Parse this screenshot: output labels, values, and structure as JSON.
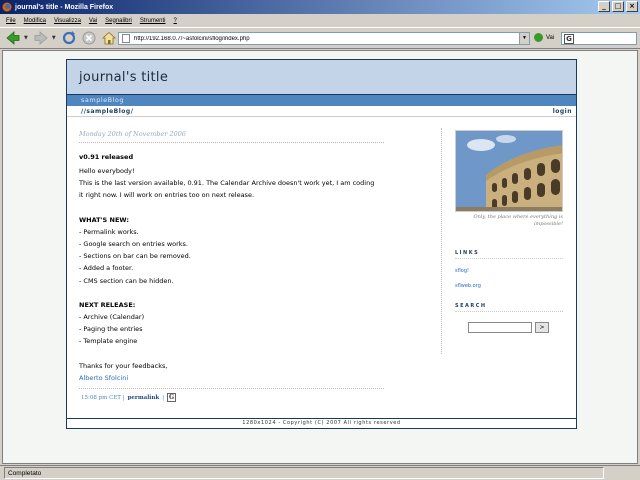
{
  "window": {
    "title": "journal's title - Mozilla Firefox",
    "buttons": {
      "minimize": "_",
      "maximize": "□",
      "close": "×"
    }
  },
  "menu": [
    "File",
    "Modifica",
    "Visualizza",
    "Vai",
    "Segnalibri",
    "Strumenti",
    "?"
  ],
  "toolbar": {
    "url": "http://192.168.0.7/~asfolcini/sflog/index.php",
    "go_label": "Vai",
    "icons": [
      "back-icon",
      "forward-icon",
      "reload-icon",
      "stop-icon",
      "home-icon"
    ]
  },
  "blog": {
    "title": "journal's title",
    "blog_name": "sampleBlog",
    "breadcrumb": "//sampleBlog/",
    "login": "login",
    "post": {
      "date": "Monday 20th of November 2006",
      "title": "v0.91 released",
      "greeting": "Hello everybody!",
      "intro_1": "This is the last version available, 0.91. The Calendar Archive doesn't work yet, I am coding",
      "intro_2": "it right now. I will work on entries too on next release.",
      "whats_new_heading": "WHAT'S NEW:",
      "whats_new": [
        "- Permalink works.",
        "- Google search on entries works.",
        "- Sections on bar can be removed.",
        "- Added a footer.",
        "- CMS section can be hidden."
      ],
      "next_release_heading": "NEXT RELEASE:",
      "next_release": [
        "- Archive (Calendar)",
        "- Paging the entries",
        "- Template engine"
      ],
      "thanks": "Thanks for your feedbacks,",
      "author": "Alberto Sfolcini",
      "footer_time": "15:08 pm CET |",
      "permalink": "permalink",
      "footer_sep": "|",
      "google_btn": "G"
    },
    "sidebar": {
      "caption": "Only, the place where everything is impossible!",
      "links_heading": "LINKS",
      "links": [
        "sflog!",
        "sflweb.org"
      ],
      "search_heading": "SEARCH",
      "search_button": ">"
    },
    "copyright": "1280x1024 - Copyright (C) 2007 All rights reserved"
  },
  "status": "Completato"
}
